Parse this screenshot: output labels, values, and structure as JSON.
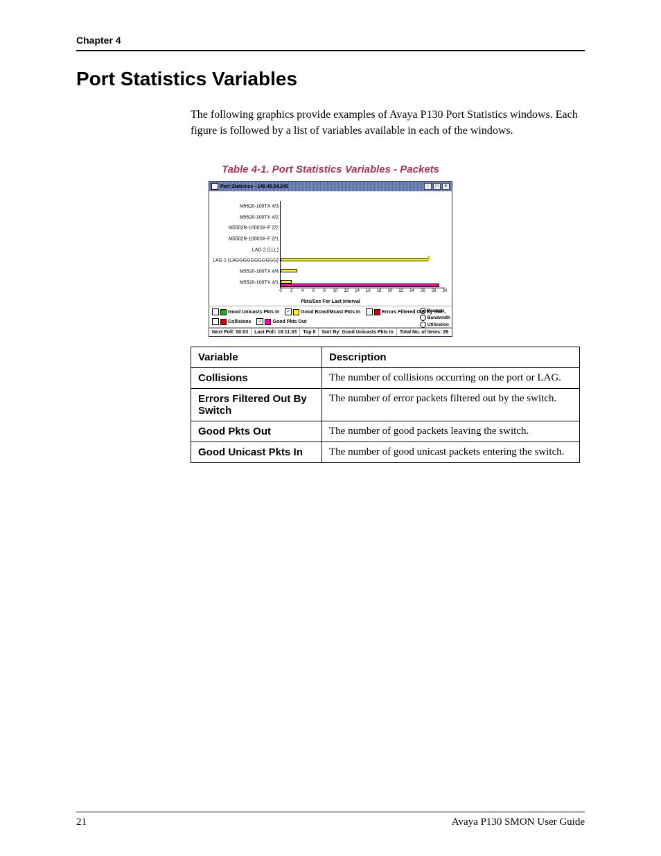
{
  "header": {
    "chapter": "Chapter 4"
  },
  "title": "Port Statistics Variables",
  "intro": "The following graphics provide examples of Avaya P130 Port Statistics windows. Each figure is followed by a list of variables available in each of the windows.",
  "figure": {
    "caption": "Table 4-1.  Port Statistics Variables - Packets",
    "window_title": "Port Statistics - 149.49.54.245",
    "xlabel": "Pkts/Sec For Last Interval",
    "legend": {
      "a": "Good Unicasts Pkts In",
      "b": "Good Bcast/Mcast Pkts In",
      "c": "Errors Filtered Out By Swi...",
      "d": "Collisions",
      "e": "Good Pkts Out",
      "radios": {
        "pk": "Packets",
        "bw": "Bandwidth",
        "ut": "Utilization"
      }
    },
    "status": {
      "next": "Next Poll: 00:03",
      "last": "Last Poll: 18:11:33",
      "top": "Top 8",
      "sort": "Sort By: Good Unicasts Pkts In",
      "total": "Total No. of Items: 26"
    }
  },
  "chart_data": {
    "type": "bar",
    "categories": [
      "M5520-100TX 4/3",
      "M5520-100TX 4/2",
      "M5502R-1000SX-F 2/2",
      "M5502R-1000SX-F 2/1",
      "LAG 2 (LLL)",
      "LAG 1 (LAGGGGGGGGGGG)",
      "M5520-100TX 4/4",
      "M5520-100TX 4/1"
    ],
    "series": [
      {
        "name": "Good Unicasts Pkts In",
        "values": [
          0,
          0,
          0,
          0,
          0,
          27,
          3,
          2
        ]
      },
      {
        "name": "Good Pkts Out",
        "values": [
          0,
          0,
          0,
          0,
          0,
          0,
          0,
          29
        ]
      }
    ],
    "xlim": [
      0,
      30
    ],
    "xticks": [
      0,
      2,
      4,
      6,
      8,
      10,
      12,
      14,
      16,
      18,
      20,
      22,
      24,
      26,
      28,
      30
    ],
    "xlabel": "Pkts/Sec For Last Interval"
  },
  "vars_table": {
    "headers": {
      "var": "Variable",
      "desc": "Description"
    },
    "rows": [
      {
        "var": "Collisions",
        "desc": "The number of collisions occurring on the port or LAG."
      },
      {
        "var": "Errors Filtered Out By Switch",
        "desc": "The number of error packets filtered out by the switch."
      },
      {
        "var": "Good Pkts Out",
        "desc": "The number of good packets leaving the switch."
      },
      {
        "var": "Good Unicast Pkts In",
        "desc": "The number of good unicast packets entering the switch."
      }
    ]
  },
  "footer": {
    "page": "21",
    "guide": "Avaya P130 SMON User Guide"
  }
}
